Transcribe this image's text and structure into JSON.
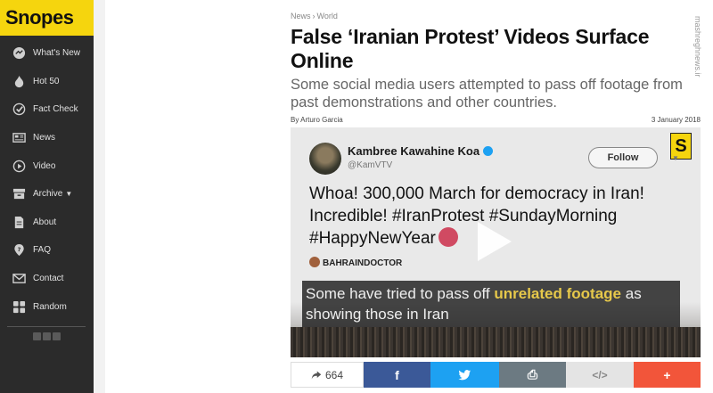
{
  "sidebar": {
    "logo": "Snopes",
    "items": [
      {
        "label": "What's New",
        "icon": "whats-new-icon"
      },
      {
        "label": "Hot 50",
        "icon": "flame-icon"
      },
      {
        "label": "Fact Check",
        "icon": "check-circle-icon"
      },
      {
        "label": "News",
        "icon": "newspaper-icon"
      },
      {
        "label": "Video",
        "icon": "play-circle-icon"
      },
      {
        "label": "Archive",
        "icon": "archive-icon"
      },
      {
        "label": "About",
        "icon": "document-icon"
      },
      {
        "label": "FAQ",
        "icon": "question-marker-icon"
      },
      {
        "label": "Contact",
        "icon": "envelope-icon"
      },
      {
        "label": "Random",
        "icon": "dice-icon"
      }
    ]
  },
  "article": {
    "breadcrumb": [
      "News",
      "World"
    ],
    "title": "False ‘Iranian Protest’ Videos Surface Online",
    "subtitle": "Some social media users attempted to pass off footage from past demonstrations and other countries.",
    "byline": "By Arturo Garcia",
    "date": "3 January 2018"
  },
  "video": {
    "tweet_name": "Kambree Kawahine Koa",
    "tweet_handle": "@KamVTV",
    "follow_label": "Follow",
    "tweet_text": "Whoa! 300,000 March for democracy in Iran! Incredible! #IranProtest #SundayMorning #HappyNewYear",
    "source": "BAHRAINDOCTOR",
    "caption_pre": "Some have tried to pass off",
    "caption_hl": "unrelated footage",
    "caption_post": "as showing those in Iran",
    "logo_letter": "S"
  },
  "share": {
    "count": "664",
    "facebook": "f",
    "print": "⎙",
    "embed": "</>",
    "more": "+"
  },
  "watermark": "mashreghnews.ir",
  "colors": {
    "brand": "#f5d50e",
    "sidebar": "#2b2b2b",
    "facebook": "#3b5998",
    "twitter": "#1da1f2",
    "plus": "#f2553a"
  }
}
